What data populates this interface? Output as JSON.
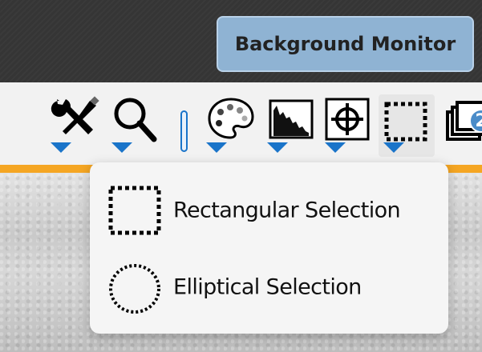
{
  "header": {
    "background_monitor_label": "Background Monitor"
  },
  "toolbar": {
    "tools": [
      {
        "name": "tools",
        "icon": "wrench-screwdriver-icon",
        "has_dropdown": true
      },
      {
        "name": "zoom",
        "icon": "magnifier-icon",
        "has_dropdown": true
      },
      {
        "name": "separator",
        "icon": "separator-icon",
        "has_dropdown": false
      },
      {
        "name": "color",
        "icon": "palette-icon",
        "has_dropdown": true
      },
      {
        "name": "histogram",
        "icon": "histogram-icon",
        "has_dropdown": true
      },
      {
        "name": "target",
        "icon": "crosshair-icon",
        "has_dropdown": true
      },
      {
        "name": "selection",
        "icon": "rectangle-selection-icon",
        "has_dropdown": true,
        "active": true
      },
      {
        "name": "layers",
        "icon": "layers-icon",
        "has_dropdown": false
      }
    ],
    "badge_count": "2",
    "accent_color": "#1a74c9",
    "underline_color": "#f5a623"
  },
  "selection_menu": {
    "items": [
      {
        "label": "Rectangular Selection",
        "icon": "rectangle-selection-icon"
      },
      {
        "label": "Elliptical Selection",
        "icon": "ellipse-selection-icon"
      }
    ]
  }
}
